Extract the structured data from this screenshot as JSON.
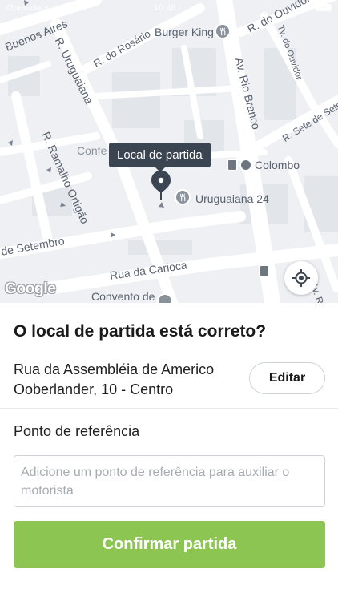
{
  "status_bar": {
    "carrier": "Operadora",
    "time": "10:48"
  },
  "map": {
    "streets": [
      "Buenos Aires",
      "R. Uruguaiana",
      "R. do Rosário",
      "R. do Ouvidor",
      "Tv. do Ouvidor",
      "Av. Rio Branco",
      "R. Sete de Setembro",
      "R. Ramalho Ortigão",
      "de Setembro",
      "Rua da Carioca",
      "Av. R"
    ],
    "pois": {
      "burger_king": "Burger King",
      "colombo": "Colombo",
      "uruguaiana": "Uruguaiana 24",
      "convento": "Convento de",
      "confeitaria": "Confe"
    },
    "tooltip": "Local de partida",
    "google_logo": "Google"
  },
  "sheet": {
    "question": "O local de partida está correto?",
    "address": "Rua da Assembléia de Americo Ooberlander, 10 - Centro",
    "edit_label": "Editar",
    "reference_label": "Ponto de referência",
    "reference_placeholder": "Adicione um ponto de referência para auxiliar o motorista",
    "reference_value": "",
    "confirm_label": "Confirmar partida"
  },
  "colors": {
    "accent": "#8dc553",
    "tooltip_bg": "#3b4451",
    "map_bg": "#eef0f3"
  },
  "icons": [
    "restaurant-icon",
    "metro-icon",
    "bus-icon",
    "map-pin-icon",
    "my-location-icon"
  ]
}
